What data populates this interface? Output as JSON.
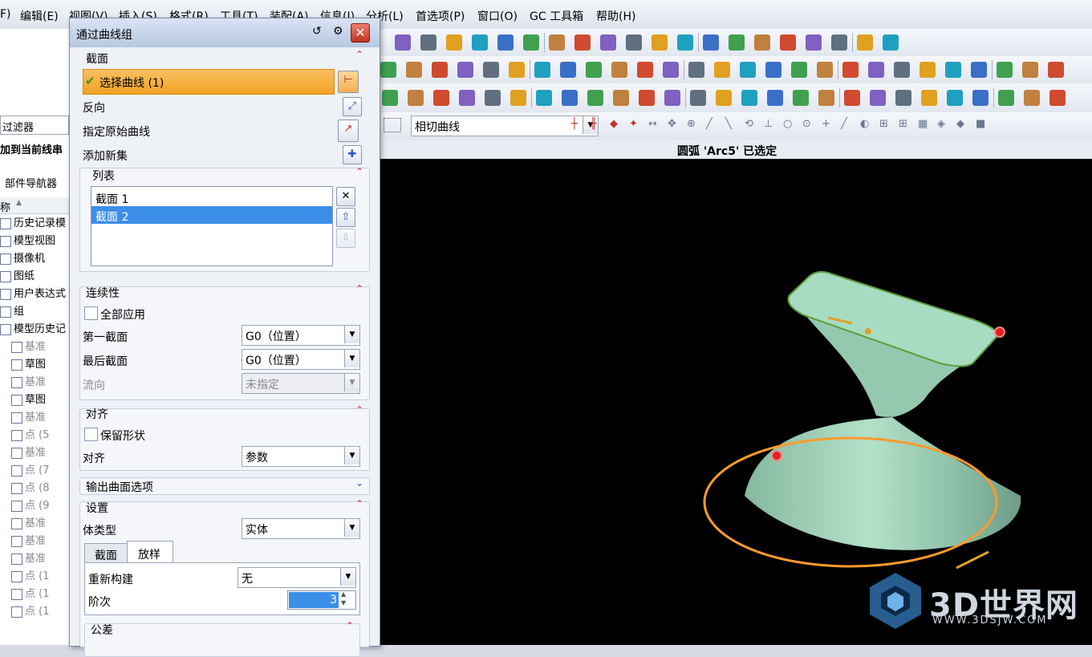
{
  "menubar": {
    "items": [
      "F)",
      "编辑(E)",
      "视图(V)",
      "插入(S)",
      "格式(R)",
      "工具(T)",
      "装配(A)",
      "信息(I)",
      "分析(L)",
      "首选项(P)",
      "窗口(O)",
      "GC 工具箱",
      "帮助(H)"
    ]
  },
  "toolbar": {
    "curve_rule": "相切曲线"
  },
  "status": {
    "message": "圆弧 'Arc5' 已选定"
  },
  "leftnav": {
    "filter_label": "过滤器",
    "add_to_string": "加到当前线串",
    "part_navigator": "部件导航器",
    "name_header": "称",
    "items": [
      {
        "label": "历史记录模",
        "dim": false
      },
      {
        "label": "模型视图",
        "dim": false
      },
      {
        "label": "摄像机",
        "dim": false
      },
      {
        "label": "图纸",
        "dim": false
      },
      {
        "label": "用户表达式",
        "dim": false
      },
      {
        "label": "组",
        "dim": false
      },
      {
        "label": "模型历史记",
        "dim": false
      },
      {
        "label": "基准",
        "dim": true
      },
      {
        "label": "草图",
        "dim": false
      },
      {
        "label": "基准",
        "dim": true
      },
      {
        "label": "草图",
        "dim": false
      },
      {
        "label": "基准",
        "dim": true
      },
      {
        "label": "点 (5",
        "dim": true
      },
      {
        "label": "基准",
        "dim": true
      },
      {
        "label": "点 (7",
        "dim": true
      },
      {
        "label": "点 (8",
        "dim": true
      },
      {
        "label": "点 (9",
        "dim": true
      },
      {
        "label": "基准",
        "dim": true
      },
      {
        "label": "基准",
        "dim": true
      },
      {
        "label": "基准",
        "dim": true
      },
      {
        "label": "点 (1",
        "dim": true
      },
      {
        "label": "点 (1",
        "dim": true
      },
      {
        "label": "点 (1",
        "dim": true
      }
    ]
  },
  "dialog": {
    "title": "通过曲线组",
    "section": {
      "header": "截面",
      "select_curve": "选择曲线 (1)",
      "reverse": "反向",
      "specify_origin": "指定原始曲线",
      "add_new_set": "添加新集"
    },
    "list": {
      "header": "列表",
      "rows": [
        "截面 1",
        "截面 2"
      ],
      "selected_index": 1
    },
    "continuity": {
      "header": "连续性",
      "apply_all": "全部应用",
      "first_section_label": "第一截面",
      "first_section_value": "G0（位置）",
      "last_section_label": "最后截面",
      "last_section_value": "G0（位置）",
      "flow_label": "流向",
      "flow_value": "未指定"
    },
    "alignment": {
      "header": "对齐",
      "preserve_shape": "保留形状",
      "align_label": "对齐",
      "align_value": "参数"
    },
    "output_surface": {
      "header": "输出曲面选项"
    },
    "settings": {
      "header": "设置",
      "body_type_label": "体类型",
      "body_type_value": "实体",
      "tabs": [
        "截面",
        "放样"
      ],
      "active_tab": 1,
      "rebuild_label": "重新构建",
      "rebuild_value": "无",
      "degree_label": "阶次",
      "degree_value": "3"
    },
    "tolerance": {
      "header": "公差"
    }
  },
  "watermark": {
    "brand": "3D世界网",
    "url": "WWW.3DSJW.COM"
  },
  "colors": {
    "viewport_bg": "#000000",
    "surface": "#9fd1b8",
    "highlight_curve": "#ff9a2e",
    "select_active": "#f3a224"
  }
}
